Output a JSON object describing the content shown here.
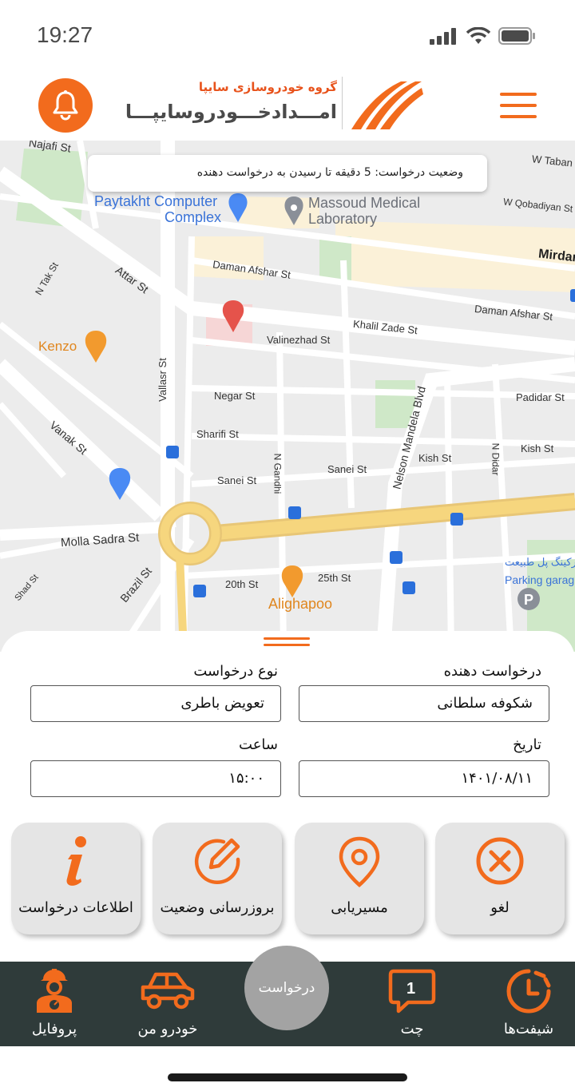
{
  "status_bar": {
    "time": "19:27"
  },
  "header": {
    "brand_top": "گروه خودروسازی سایپا",
    "brand_main": "امـــدادخـــودروسایپـــا"
  },
  "map": {
    "toast": "وضعیت درخواست: 5 دقیقه تا رسیدن به درخواست دهنده",
    "streets": {
      "najafi": "Najafi St",
      "w_taban": "W Taban",
      "w_qobadiyan": "W Qobadiyan St",
      "mirdamad": "Mirdar",
      "attar": "Attar St",
      "n_tak": "N Tak St",
      "daman_afshar_1": "Daman Afshar St",
      "daman_afshar_2": "Daman Afshar St",
      "khalil_zade": "Khalil Zade St",
      "valinezhad": "Valinezhad St",
      "vallasr": "Vallasr St",
      "negar": "Negar St",
      "sharifi": "Sharifi St",
      "vanak": "Vanak St",
      "sanei_1": "Sanei St",
      "sanei_2": "Sanei St",
      "n_gandhi": "N Gandhi",
      "nelson_mandela": "Nelson Mandela Blvd",
      "padidar": "Padidar St",
      "kish_1": "Kish St",
      "kish_2": "Kish St",
      "n_didar": "N Didar",
      "molla_sadra": "Molla Sadra St",
      "brazil": "Brazil St",
      "shad": "Shad St",
      "st_20th": "20th St",
      "st_25th": "25th St"
    },
    "places": {
      "paytakht_line1": "Paytakht Computer",
      "paytakht_line2": "Complex",
      "massoud_line1": "Massoud Medical",
      "massoud_line2": "Laboratory",
      "kenzo": "Kenzo",
      "alighapoo": "Alighapoo",
      "parking_fa": "پارکینگ پل طبیعت",
      "parking_en": "Parking garag"
    }
  },
  "request": {
    "requester_label": "درخواست دهنده",
    "requester_value": "شکوفه سلطانی",
    "type_label": "نوع درخواست",
    "type_value": "تعویض باطری",
    "date_label": "تاریخ",
    "date_value": "۱۴۰۱/۰۸/۱۱",
    "time_label": "ساعت",
    "time_value": "۱۵:۰۰"
  },
  "actions": [
    {
      "label": "لغو",
      "icon": "cancel-icon"
    },
    {
      "label": "مسیریابی",
      "icon": "location-pin-icon"
    },
    {
      "label": "بروزرسانی وضعیت",
      "icon": "edit-icon"
    },
    {
      "label": "اطلاعات درخواست",
      "icon": "info-icon"
    }
  ],
  "nav": {
    "shifts": "شیفت‌ها",
    "chat": "چت",
    "chat_badge": "1",
    "request": "درخواست",
    "my_car": "خودرو من",
    "profile": "پروفایل"
  },
  "colors": {
    "accent": "#f26b1d",
    "nav_bg": "#2f3b3a",
    "button_bg": "#e5e5e5"
  }
}
